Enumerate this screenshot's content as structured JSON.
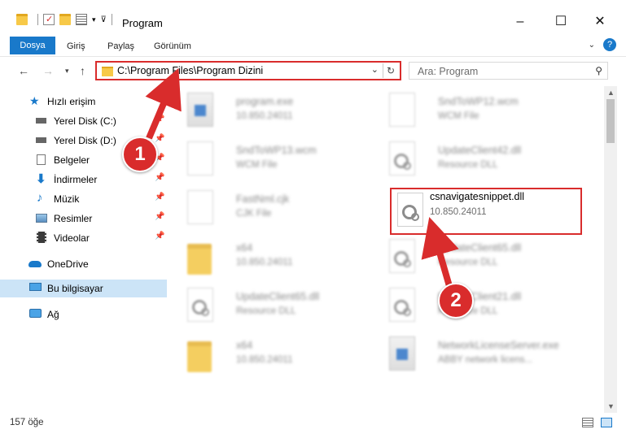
{
  "window": {
    "title": "Program",
    "minimize": "–",
    "maximize": "☐",
    "close": "✕"
  },
  "ribbon": {
    "tabs": [
      "Dosya",
      "Giriş",
      "Paylaş",
      "Görünüm"
    ],
    "help": "?"
  },
  "address": {
    "path": "C:\\Program Files\\Program Dizini"
  },
  "search": {
    "placeholder": "Ara: Program"
  },
  "sidebar": {
    "items": [
      {
        "label": "Hızlı erişim",
        "icon": "star-icon"
      },
      {
        "label": "Yerel Disk (C:)",
        "icon": "drive-icon",
        "pinned": true
      },
      {
        "label": "Yerel Disk (D:)",
        "icon": "drive-icon",
        "pinned": true
      },
      {
        "label": "Belgeler",
        "icon": "documents-icon",
        "pinned": true
      },
      {
        "label": "İndirmeler",
        "icon": "download-icon",
        "pinned": true
      },
      {
        "label": "Müzik",
        "icon": "music-icon",
        "pinned": true
      },
      {
        "label": "Resimler",
        "icon": "pictures-icon",
        "pinned": true
      },
      {
        "label": "Videolar",
        "icon": "video-icon",
        "pinned": true
      },
      {
        "label": "OneDrive",
        "icon": "cloud-icon"
      },
      {
        "label": "Bu bilgisayar",
        "icon": "computer-icon",
        "selected": true
      },
      {
        "label": "Ağ",
        "icon": "network-icon"
      }
    ]
  },
  "files": [
    {
      "name": "program.exe",
      "desc": "10.850.24011",
      "icon": "app-icon"
    },
    {
      "name": "SndToWP12.wcm",
      "desc": "WCM File",
      "icon": "document-icon"
    },
    {
      "name": "SndToWP13.wcm",
      "desc": "WCM File",
      "icon": "document-icon"
    },
    {
      "name": "UpdateClient42.dll",
      "desc": "Resource DLL",
      "icon": "dll-gear-icon"
    },
    {
      "name": "FastNml.cjk",
      "desc": "CJK File",
      "icon": "document-icon"
    },
    {
      "name": "csnavigatesnippet.dll",
      "desc": "10.850.24011",
      "icon": "dll-gear-icon"
    },
    {
      "name": "x64",
      "desc": "10.850.24011",
      "icon": "folder-icon"
    },
    {
      "name": "UpdateClient65.dll",
      "desc": "Resource DLL",
      "icon": "dll-gear-icon"
    },
    {
      "name": "UpdateClient65.dll",
      "desc": "Resource DLL",
      "icon": "dll-gear-icon"
    },
    {
      "name": "UpdateClient21.dll",
      "desc": "Resource DLL",
      "icon": "dll-gear-icon"
    },
    {
      "name": "x64",
      "desc": "10.850.24011",
      "icon": "folder-icon"
    },
    {
      "name": "NetworkLicenseServer.exe",
      "desc": "ABBY network licens...",
      "icon": "exe-icon"
    }
  ],
  "status": {
    "count": "157 öğe"
  },
  "annotations": [
    "1",
    "2"
  ],
  "colors": {
    "accent": "#1979ca",
    "highlight": "#d92c2c",
    "selected": "#cce4f7"
  }
}
